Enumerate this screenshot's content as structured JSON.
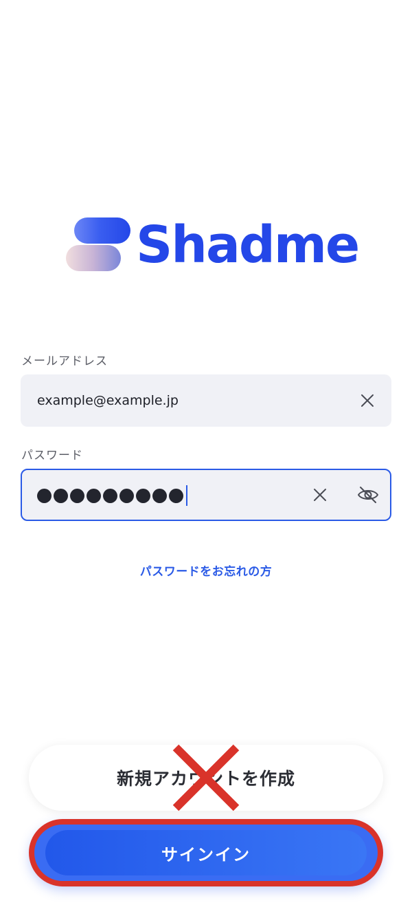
{
  "brand": {
    "name": "Shadme",
    "color": "#2447e8"
  },
  "form": {
    "email": {
      "label": "メールアドレス",
      "value": "example@example.jp"
    },
    "password": {
      "label": "パスワード",
      "masked_length": 9
    },
    "forgot_label": "パスワードをお忘れの方"
  },
  "buttons": {
    "create_account_label": "新規アカウントを作成",
    "signin_label": "サインイン"
  },
  "icons": {
    "clear_email": "close-icon",
    "clear_password": "close-icon",
    "toggle_visibility": "eye-off-icon"
  },
  "annotations": {
    "cross_color": "#d9332a",
    "highlight_color": "#d9332a"
  }
}
